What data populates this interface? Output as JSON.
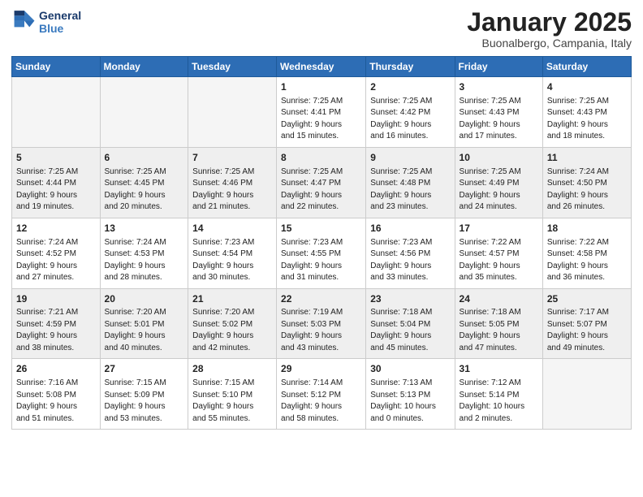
{
  "header": {
    "logo_line1": "General",
    "logo_line2": "Blue",
    "month": "January 2025",
    "location": "Buonalbergo, Campania, Italy"
  },
  "days_of_week": [
    "Sunday",
    "Monday",
    "Tuesday",
    "Wednesday",
    "Thursday",
    "Friday",
    "Saturday"
  ],
  "weeks": [
    [
      {
        "day": "",
        "info": ""
      },
      {
        "day": "",
        "info": ""
      },
      {
        "day": "",
        "info": ""
      },
      {
        "day": "1",
        "info": "Sunrise: 7:25 AM\nSunset: 4:41 PM\nDaylight: 9 hours\nand 15 minutes."
      },
      {
        "day": "2",
        "info": "Sunrise: 7:25 AM\nSunset: 4:42 PM\nDaylight: 9 hours\nand 16 minutes."
      },
      {
        "day": "3",
        "info": "Sunrise: 7:25 AM\nSunset: 4:43 PM\nDaylight: 9 hours\nand 17 minutes."
      },
      {
        "day": "4",
        "info": "Sunrise: 7:25 AM\nSunset: 4:43 PM\nDaylight: 9 hours\nand 18 minutes."
      }
    ],
    [
      {
        "day": "5",
        "info": "Sunrise: 7:25 AM\nSunset: 4:44 PM\nDaylight: 9 hours\nand 19 minutes."
      },
      {
        "day": "6",
        "info": "Sunrise: 7:25 AM\nSunset: 4:45 PM\nDaylight: 9 hours\nand 20 minutes."
      },
      {
        "day": "7",
        "info": "Sunrise: 7:25 AM\nSunset: 4:46 PM\nDaylight: 9 hours\nand 21 minutes."
      },
      {
        "day": "8",
        "info": "Sunrise: 7:25 AM\nSunset: 4:47 PM\nDaylight: 9 hours\nand 22 minutes."
      },
      {
        "day": "9",
        "info": "Sunrise: 7:25 AM\nSunset: 4:48 PM\nDaylight: 9 hours\nand 23 minutes."
      },
      {
        "day": "10",
        "info": "Sunrise: 7:25 AM\nSunset: 4:49 PM\nDaylight: 9 hours\nand 24 minutes."
      },
      {
        "day": "11",
        "info": "Sunrise: 7:24 AM\nSunset: 4:50 PM\nDaylight: 9 hours\nand 26 minutes."
      }
    ],
    [
      {
        "day": "12",
        "info": "Sunrise: 7:24 AM\nSunset: 4:52 PM\nDaylight: 9 hours\nand 27 minutes."
      },
      {
        "day": "13",
        "info": "Sunrise: 7:24 AM\nSunset: 4:53 PM\nDaylight: 9 hours\nand 28 minutes."
      },
      {
        "day": "14",
        "info": "Sunrise: 7:23 AM\nSunset: 4:54 PM\nDaylight: 9 hours\nand 30 minutes."
      },
      {
        "day": "15",
        "info": "Sunrise: 7:23 AM\nSunset: 4:55 PM\nDaylight: 9 hours\nand 31 minutes."
      },
      {
        "day": "16",
        "info": "Sunrise: 7:23 AM\nSunset: 4:56 PM\nDaylight: 9 hours\nand 33 minutes."
      },
      {
        "day": "17",
        "info": "Sunrise: 7:22 AM\nSunset: 4:57 PM\nDaylight: 9 hours\nand 35 minutes."
      },
      {
        "day": "18",
        "info": "Sunrise: 7:22 AM\nSunset: 4:58 PM\nDaylight: 9 hours\nand 36 minutes."
      }
    ],
    [
      {
        "day": "19",
        "info": "Sunrise: 7:21 AM\nSunset: 4:59 PM\nDaylight: 9 hours\nand 38 minutes."
      },
      {
        "day": "20",
        "info": "Sunrise: 7:20 AM\nSunset: 5:01 PM\nDaylight: 9 hours\nand 40 minutes."
      },
      {
        "day": "21",
        "info": "Sunrise: 7:20 AM\nSunset: 5:02 PM\nDaylight: 9 hours\nand 42 minutes."
      },
      {
        "day": "22",
        "info": "Sunrise: 7:19 AM\nSunset: 5:03 PM\nDaylight: 9 hours\nand 43 minutes."
      },
      {
        "day": "23",
        "info": "Sunrise: 7:18 AM\nSunset: 5:04 PM\nDaylight: 9 hours\nand 45 minutes."
      },
      {
        "day": "24",
        "info": "Sunrise: 7:18 AM\nSunset: 5:05 PM\nDaylight: 9 hours\nand 47 minutes."
      },
      {
        "day": "25",
        "info": "Sunrise: 7:17 AM\nSunset: 5:07 PM\nDaylight: 9 hours\nand 49 minutes."
      }
    ],
    [
      {
        "day": "26",
        "info": "Sunrise: 7:16 AM\nSunset: 5:08 PM\nDaylight: 9 hours\nand 51 minutes."
      },
      {
        "day": "27",
        "info": "Sunrise: 7:15 AM\nSunset: 5:09 PM\nDaylight: 9 hours\nand 53 minutes."
      },
      {
        "day": "28",
        "info": "Sunrise: 7:15 AM\nSunset: 5:10 PM\nDaylight: 9 hours\nand 55 minutes."
      },
      {
        "day": "29",
        "info": "Sunrise: 7:14 AM\nSunset: 5:12 PM\nDaylight: 9 hours\nand 58 minutes."
      },
      {
        "day": "30",
        "info": "Sunrise: 7:13 AM\nSunset: 5:13 PM\nDaylight: 10 hours\nand 0 minutes."
      },
      {
        "day": "31",
        "info": "Sunrise: 7:12 AM\nSunset: 5:14 PM\nDaylight: 10 hours\nand 2 minutes."
      },
      {
        "day": "",
        "info": ""
      }
    ]
  ]
}
